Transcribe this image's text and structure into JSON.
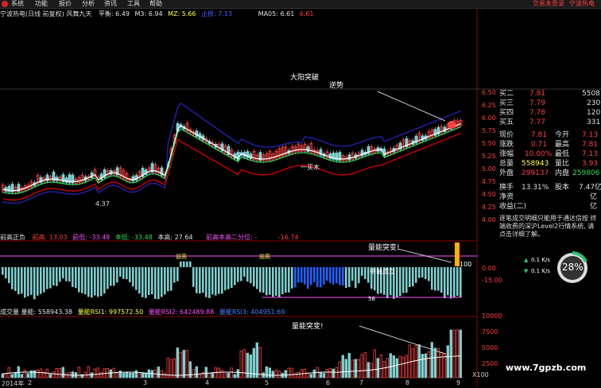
{
  "menu": {
    "items": [
      "系统",
      "功能",
      "报价",
      "分析",
      "资讯",
      "工具",
      "帮助"
    ],
    "right_note": "交易未登录",
    "right_app": "宁波热电"
  },
  "header": {
    "title": "宁波热电(日线 前复权) 风舞九天",
    "indicators": [
      {
        "label": "平衡: 6.49",
        "color": "#e0e0e0"
      },
      {
        "label": "M3: 6.94",
        "color": "#e0e0e0"
      },
      {
        "label": "MZ: 5.66",
        "color": "#ffff40"
      },
      {
        "label": "止损: 7.13",
        "color": "#4060ff"
      },
      {
        "label": "MA05: 6.61",
        "color": "#e0e0e0"
      },
      {
        "label": "6.61",
        "color": "#ff4040"
      }
    ]
  },
  "annotations": {
    "sun_break": "大阳突破",
    "inverse": "逆势",
    "low_price": "4.37",
    "buy_signal": "一买木",
    "volume_break_1": "量能突变!",
    "volume_break_2": "量能突变!",
    "cross_label": "中轴成立",
    "hundred": "100"
  },
  "price_axis": [
    "6.50",
    "6.25",
    "6.00",
    "5.75",
    "5.50",
    "5.25",
    "5.00",
    "4.75",
    "4.50",
    "4.25",
    "4.00"
  ],
  "quote": {
    "asks": [
      {
        "name": "买二",
        "price": "7.81",
        "vol": "5508"
      },
      {
        "name": "买三",
        "price": "7.79",
        "vol": "230"
      },
      {
        "name": "买四",
        "price": "7.78",
        "vol": "120"
      },
      {
        "name": "买五",
        "price": "7.77",
        "vol": "331"
      }
    ],
    "stats": [
      {
        "l1": "现价",
        "v1": "7.81",
        "l2": "今开",
        "v2": "7.13"
      },
      {
        "l1": "涨跌",
        "v1": "0.71",
        "l2": "最高",
        "v2": "7.81"
      },
      {
        "l1": "涨幅",
        "v1": "10.00%",
        "l2": "最低",
        "v2": "7.13"
      },
      {
        "l1": "总量",
        "v1": "558943",
        "l2": "量比",
        "v2": "3.93"
      },
      {
        "l1": "外盘",
        "v1": "299137",
        "l2": "内盘",
        "v2": "259806"
      },
      {
        "l1": "换手",
        "v1": "13.31%",
        "l2": "股本",
        "v2": "7.47亿"
      },
      {
        "l1": "净资",
        "v1": "",
        "l2": "",
        "v2": "亿"
      },
      {
        "l1": "收益(二)",
        "v1": "",
        "l2": "",
        "v2": "亿"
      }
    ],
    "info_text": "逐笔成交明细只能用于通达信按 终端收费的深沪Level2行情系统, 请点击详细了解。"
  },
  "gauge": {
    "percent": "28%",
    "up": "0.1 K/s",
    "down": "0.1 K/s"
  },
  "mid_panel": {
    "title": "前高正负",
    "vals": [
      {
        "label": "前高: 13.03",
        "color": "#ff4040"
      },
      {
        "label": "前低: -33.48",
        "color": "#ff50ff"
      },
      {
        "label": "本低: -33.48",
        "color": "#33dd55"
      },
      {
        "label": "本高: 27.64",
        "color": "#e0e0e0"
      },
      {
        "label": "前高本高二分位: -",
        "color": "#ff50ff"
      },
      {
        "label": "-16.74",
        "color": "#ff4040"
      }
    ],
    "axis": [
      "0.00",
      "-15.00"
    ],
    "marks": [
      "前高",
      "前高",
      "58"
    ]
  },
  "low_panel": {
    "vals": [
      {
        "label": "成交量 量能: 558943.38",
        "color": "#e0e0e0"
      },
      {
        "label": "量能RSI1: 997572.50",
        "color": "#ffff40"
      },
      {
        "label": "量能RSI2: 642489.88",
        "color": "#ff50ff"
      },
      {
        "label": "量能RSI3: 404951.69",
        "color": "#4080ff"
      }
    ],
    "axis": [
      "10000",
      "7500",
      "5000",
      "2500"
    ],
    "x_unit": "X100",
    "dates": [
      "2014年",
      "2",
      "3",
      "4",
      "5",
      "6",
      "7",
      "8",
      "9"
    ]
  },
  "watermark": "www.7gpzb.com",
  "colors": {
    "red": "#ff4040",
    "green": "#33dd55",
    "cyan": "#7ecece",
    "blue": "#2020a0",
    "white": "#ffffff"
  }
}
